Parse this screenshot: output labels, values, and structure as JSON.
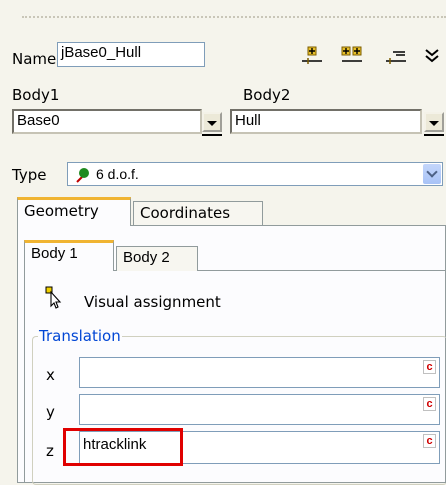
{
  "joint": {
    "name_label": "Name",
    "name_value": "jBase0_Hull",
    "body1_label": "Body1",
    "body2_label": "Body2",
    "body1_value": "Base0",
    "body2_value": "Hull",
    "type_label": "Type",
    "type_value": "6 d.o.f."
  },
  "toolbar": {
    "icons": [
      "add-joint-icon",
      "add-joints-icon",
      "list-icon",
      "more-icon"
    ]
  },
  "tabs": {
    "outer": [
      "Geometry",
      "Coordinates"
    ],
    "inner": [
      "Body 1",
      "Body 2"
    ]
  },
  "visual": {
    "label": "Visual assignment",
    "icon": "cursor-pick-icon"
  },
  "translation": {
    "group_label": "Translation",
    "x_label": "x",
    "y_label": "y",
    "z_label": "z",
    "x_value": "",
    "y_value": "",
    "z_value": "htracklink",
    "flag": "c",
    "highlight_color": "#e00000"
  }
}
